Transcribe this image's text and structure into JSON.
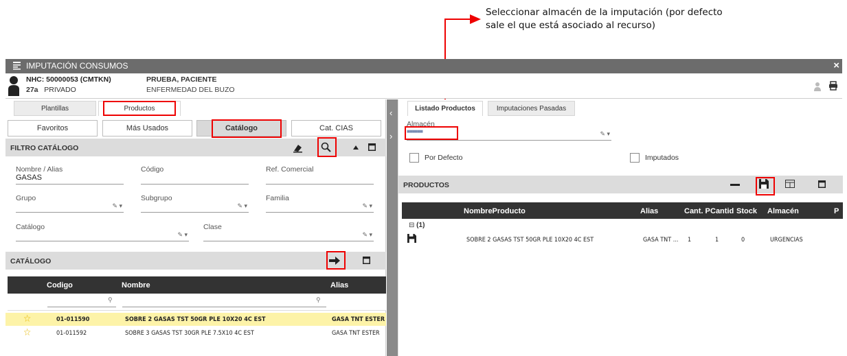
{
  "annotation": {
    "line1": "Seleccionar almacén de la imputación (por defecto",
    "line2": "sale el que está asociado al recurso)"
  },
  "window": {
    "title": "IMPUTACIÓN CONSUMOS",
    "close": "×"
  },
  "patient": {
    "nhc": "NHC: 50000053 (CMTKN)",
    "age": "27a",
    "type": "PRIVADO",
    "name": "PRUEBA, PACIENTE",
    "diagnosis": "ENFERMEDAD DEL BUZO"
  },
  "left": {
    "tabs": [
      "Plantillas",
      "Productos"
    ],
    "segments": [
      "Favoritos",
      "Más Usados",
      "Catálogo",
      "Cat. CIAS"
    ],
    "filter_title": "FILTRO CATÁLOGO",
    "fields": {
      "nombre_label": "Nombre / Alias",
      "nombre_value": "GASAS",
      "codigo_label": "Código",
      "ref_label": "Ref. Comercial",
      "grupo_label": "Grupo",
      "subgrupo_label": "Subgrupo",
      "familia_label": "Familia",
      "catalogo_label": "Catálogo",
      "clase_label": "Clase"
    },
    "catalog_title": "CATÁLOGO",
    "table": {
      "headers": [
        "Codigo",
        "Nombre",
        "Alias"
      ],
      "rows": [
        {
          "codigo": "01-011590",
          "nombre": "SOBRE 2 GASAS TST 50GR PLE 10X20 4C EST",
          "alias": "GASA TNT ESTER"
        },
        {
          "codigo": "01-011592",
          "nombre": "SOBRE 3 GASAS TST 30GR PLE 7.5X10 4C EST",
          "alias": "GASA TNT ESTER"
        }
      ]
    }
  },
  "right": {
    "tabs": [
      "Listado Productos",
      "Imputaciones Pasadas"
    ],
    "almacen_label": "Almacén",
    "almacen_value": "■■■■■■",
    "por_defecto": "Por Defecto",
    "imputados": "Imputados",
    "products_title": "PRODUCTOS",
    "table": {
      "headers": [
        "NombreProducto",
        "Alias",
        "Cant. P",
        "Cantid",
        "Stock",
        "Almacén",
        "P"
      ],
      "group": "(1)",
      "row": {
        "nombre": "SOBRE 2 GASAS TST 50GR PLE 10X20 4C EST",
        "alias": "GASA TNT ...",
        "cant_p": "1",
        "cantid": "1",
        "stock": "0",
        "almacen": "URGENCIAS"
      }
    }
  },
  "colors": {
    "highlight": "#fdf3a8",
    "accent_red": "#e00000",
    "titlebar": "#6c6c6c"
  }
}
